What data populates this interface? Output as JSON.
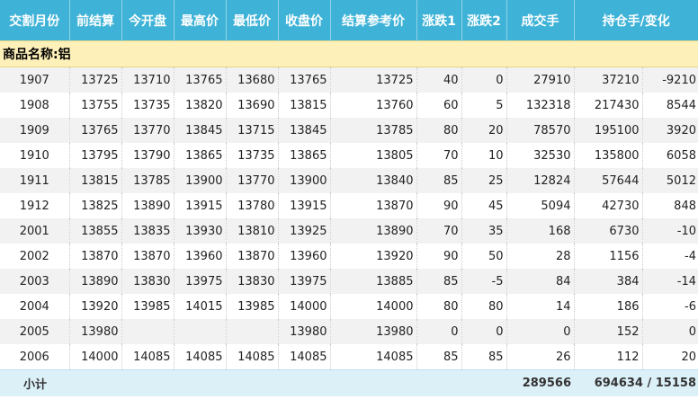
{
  "headers": [
    "交割月份",
    "前结算",
    "今开盘",
    "最高价",
    "最低价",
    "收盘价",
    "结算参考价",
    "涨跌1",
    "涨跌2",
    "成交手",
    "持仓手/变化"
  ],
  "section_label": "商品名称:铝",
  "rows": [
    [
      "1907",
      "13725",
      "13710",
      "13765",
      "13680",
      "13765",
      "13725",
      "40",
      "0",
      "27910",
      "37210",
      "-9210"
    ],
    [
      "1908",
      "13755",
      "13735",
      "13820",
      "13690",
      "13815",
      "13760",
      "60",
      "5",
      "132318",
      "217430",
      "8544"
    ],
    [
      "1909",
      "13765",
      "13770",
      "13845",
      "13715",
      "13845",
      "13785",
      "80",
      "20",
      "78570",
      "195100",
      "3920"
    ],
    [
      "1910",
      "13795",
      "13790",
      "13865",
      "13735",
      "13865",
      "13805",
      "70",
      "10",
      "32530",
      "135800",
      "6058"
    ],
    [
      "1911",
      "13815",
      "13785",
      "13900",
      "13770",
      "13900",
      "13840",
      "85",
      "25",
      "12824",
      "57644",
      "5012"
    ],
    [
      "1912",
      "13825",
      "13890",
      "13915",
      "13780",
      "13915",
      "13870",
      "90",
      "45",
      "5094",
      "42730",
      "848"
    ],
    [
      "2001",
      "13855",
      "13835",
      "13930",
      "13810",
      "13925",
      "13890",
      "70",
      "35",
      "168",
      "6730",
      "-10"
    ],
    [
      "2002",
      "13870",
      "13870",
      "13960",
      "13870",
      "13960",
      "13920",
      "90",
      "50",
      "28",
      "1156",
      "-4"
    ],
    [
      "2003",
      "13890",
      "13830",
      "13975",
      "13830",
      "13975",
      "13885",
      "85",
      "-5",
      "84",
      "384",
      "-14"
    ],
    [
      "2004",
      "13920",
      "13985",
      "14015",
      "13985",
      "14000",
      "14000",
      "80",
      "80",
      "14",
      "186",
      "-6"
    ],
    [
      "2005",
      "13980",
      "",
      "",
      "",
      "13980",
      "13980",
      "0",
      "0",
      "0",
      "152",
      "0"
    ],
    [
      "2006",
      "14000",
      "14085",
      "14085",
      "14085",
      "14085",
      "14085",
      "85",
      "85",
      "26",
      "112",
      "20"
    ]
  ],
  "subtotal": {
    "label": "小计",
    "volume": "289566",
    "open_interest": "694634 / 15158"
  }
}
